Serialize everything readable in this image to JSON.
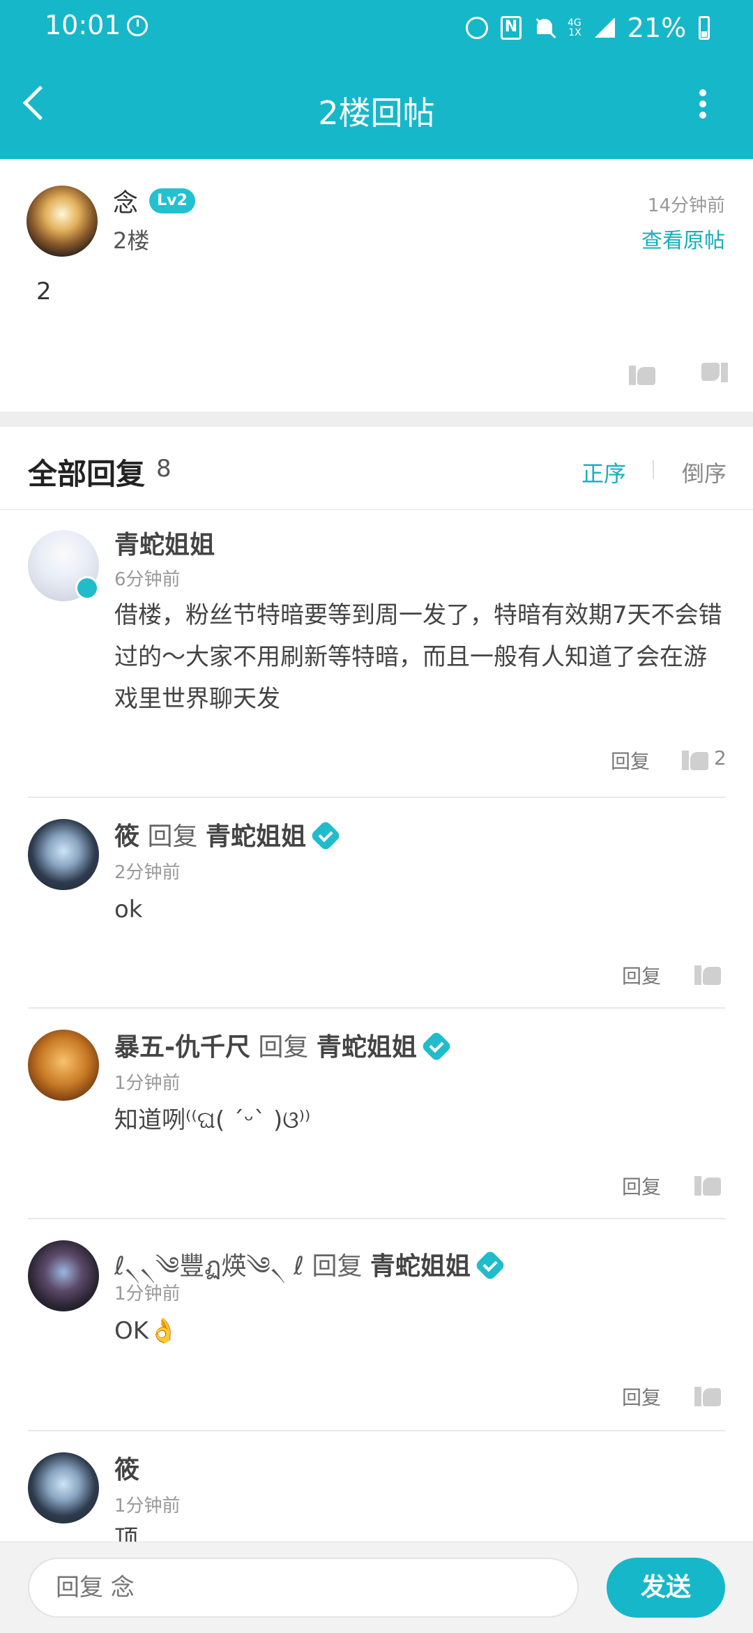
{
  "status_bar": {
    "time": "10:01",
    "network": "4G\n1X",
    "battery": "21%"
  },
  "header": {
    "title": "2楼回帖"
  },
  "post": {
    "author": "念",
    "level": "Lv2",
    "floor": "2楼",
    "time": "14分钟前",
    "view_original": "查看原帖",
    "content": "2"
  },
  "replies_header": {
    "title": "全部回复",
    "count": "8",
    "asc": "正序",
    "desc": "倒序"
  },
  "replies": [
    {
      "author": "青蛇姐姐",
      "time": "6分钟前",
      "content": "借楼，粉丝节特暗要等到周一发了，特暗有效期7天不会错过的～大家不用刷新等特暗，而且一般有人知道了会在游戏里世界聊天发",
      "reply_label": "回复",
      "likes": "2"
    },
    {
      "author": "筱",
      "reply_word": "回复",
      "target": "青蛇姐姐",
      "time": "2分钟前",
      "content": "ok",
      "reply_label": "回复"
    },
    {
      "author": "暴五-仇千尺",
      "reply_word": "回复",
      "target": "青蛇姐姐",
      "time": "1分钟前",
      "content": "知道咧⁽⁽ଘ( ˊᵕˋ )ଓ⁾⁾",
      "reply_label": "回复"
    },
    {
      "author": "ℓ৲৲༄豐ฏ煐༄৲ ℓ",
      "reply_word": "回复",
      "target": "青蛇姐姐",
      "time": "1分钟前",
      "content": "OK👌",
      "reply_label": "回复"
    },
    {
      "author": "筱",
      "time": "1分钟前",
      "content": "顶"
    }
  ],
  "input_bar": {
    "placeholder": "回复 念",
    "send": "发送"
  },
  "colors": {
    "accent": "#16b7c9",
    "verified": "#21bccb"
  }
}
